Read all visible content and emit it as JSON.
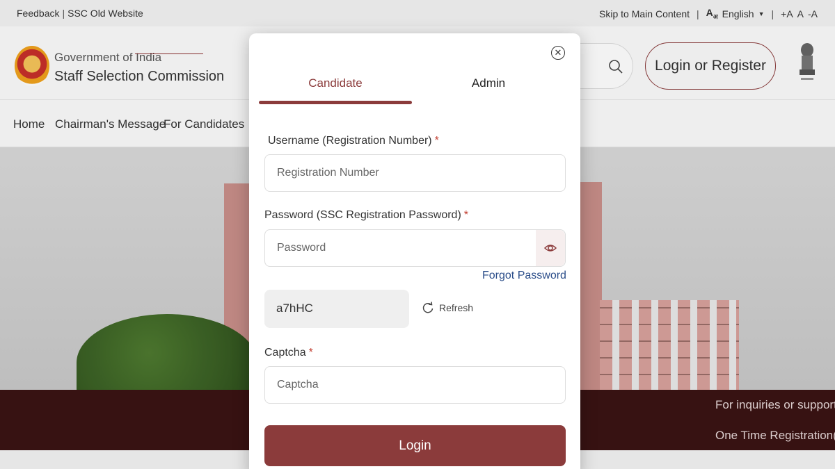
{
  "topbar": {
    "left_links": [
      "Feedback",
      "SSC Old Website"
    ],
    "skip_link": "Skip to Main Content",
    "language": "English",
    "font_controls": [
      "+A",
      "A",
      "-A"
    ]
  },
  "header": {
    "gov_label": "Government of India",
    "org_name": "Staff Selection Commission",
    "login_register": "Login or Register"
  },
  "nav": {
    "items": [
      "Home",
      "Chairman's Message",
      "For Candidates"
    ]
  },
  "banner": {
    "lines": [
      "For inquiries or support",
      "One Time Registration("
    ]
  },
  "modal": {
    "tabs": [
      "Candidate",
      "Admin"
    ],
    "active_tab": "Candidate",
    "username_label": "Username (Registration Number)",
    "username_placeholder": "Registration Number",
    "password_label": "Password (SSC Registration Password)",
    "password_placeholder": "Password",
    "forgot_password": "Forgot Password",
    "captcha_code": "a7hHC",
    "refresh_label": "Refresh",
    "captcha_label": "Captcha",
    "captcha_placeholder": "Captcha",
    "login_button": "Login",
    "required_mark": "*"
  },
  "colors": {
    "brand": "#8b3b3b",
    "link": "#2c4e8a",
    "banner_bg": "#3a1414"
  }
}
